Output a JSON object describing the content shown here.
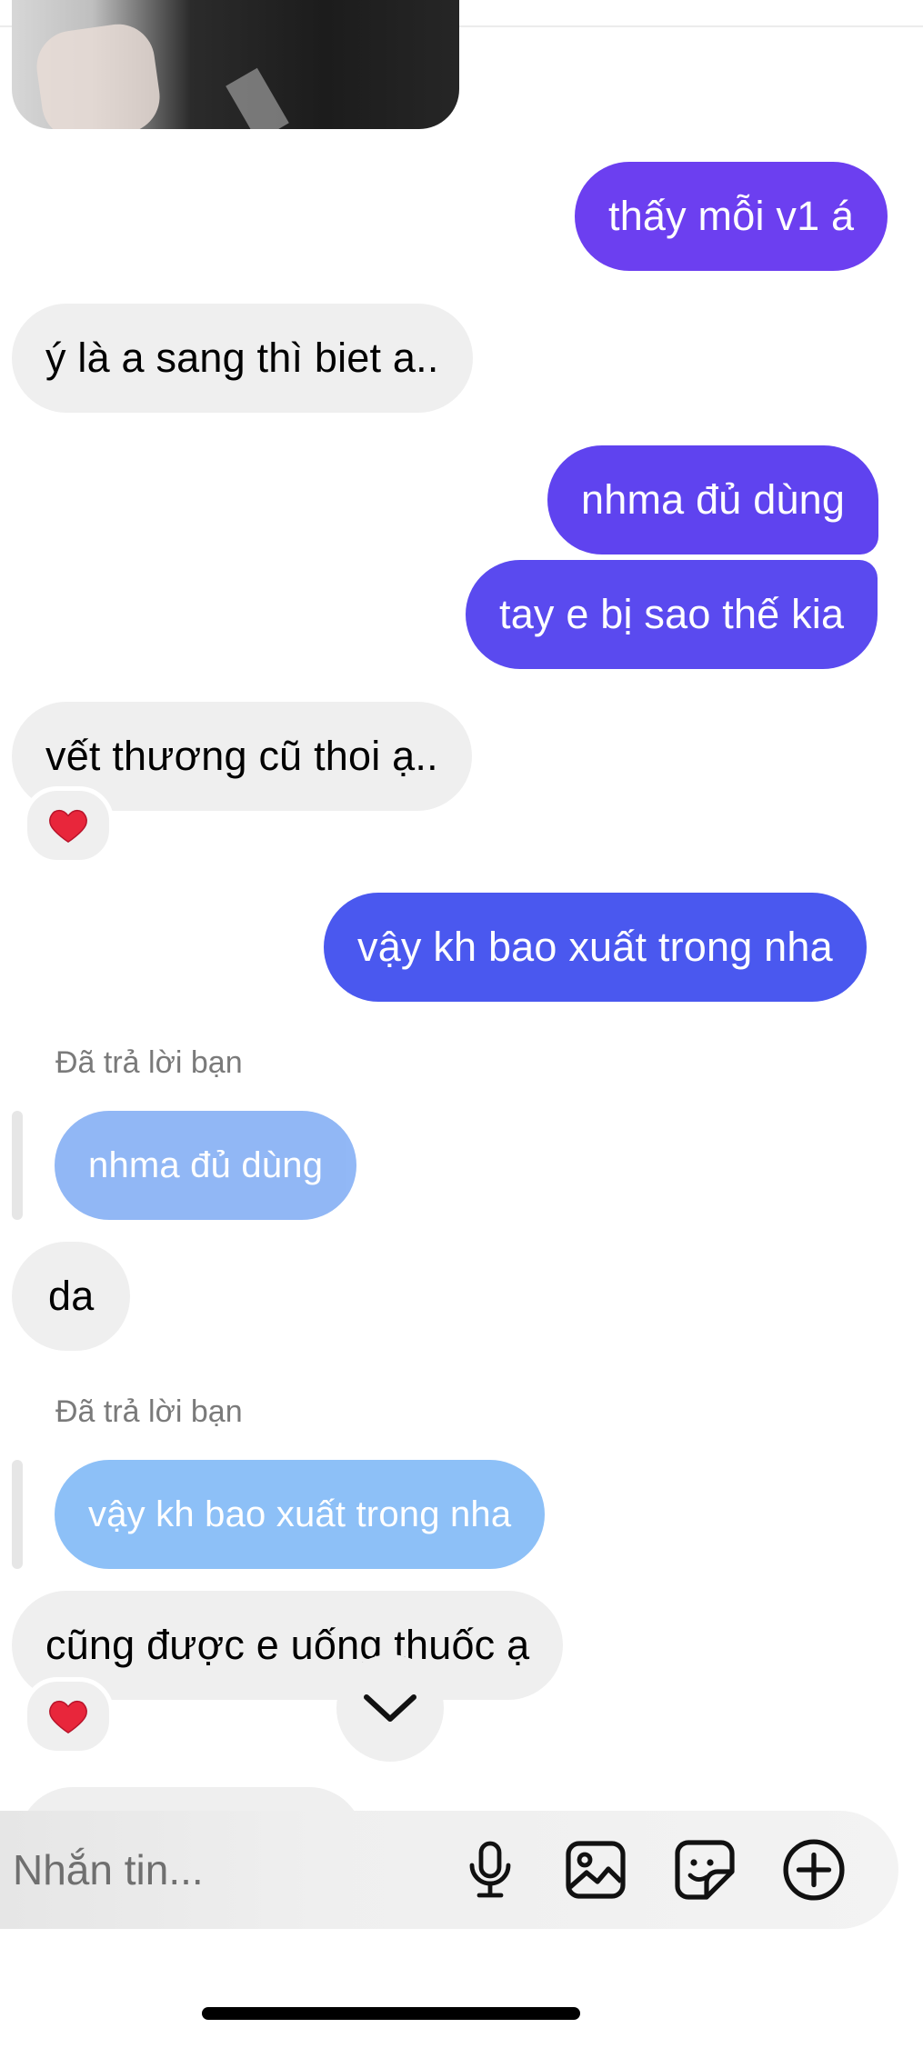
{
  "messages": [
    {
      "text": "thấy mỗi v1 á"
    },
    {
      "text": "ý là a sang thì biet a.."
    },
    {
      "text": "nhma đủ dùng"
    },
    {
      "text": "tay e bị sao thế kia"
    },
    {
      "text": "vết thương cũ thoi ạ.."
    },
    {
      "text": "vậy kh bao xuất trong nha"
    },
    {
      "text": "da"
    },
    {
      "text": "cũng được e uống thuốc ạ"
    }
  ],
  "replies": [
    {
      "label": "Đã trả lời bạn",
      "quoted": "nhma đủ dùng"
    },
    {
      "label": "Đã trả lời bạn",
      "quoted": "vậy kh bao xuất trong nha"
    }
  ],
  "reactions": {
    "emoji": "❤️",
    "icon": "heart-icon"
  },
  "composer": {
    "placeholder": "Nhắn tin..."
  },
  "icons": {
    "scroll": "chevron-down-icon",
    "mic": "microphone-icon",
    "gallery": "image-icon",
    "sticker": "sticker-icon",
    "more": "plus-circle-icon"
  },
  "colors": {
    "out_top": "#6c3ff0",
    "out_mid": "#5a46ee",
    "out_bottom": "#4a58ef",
    "reply_quote_1": "#8cb4f5",
    "reply_quote_2": "#87bdf7",
    "incoming": "#efefef"
  }
}
